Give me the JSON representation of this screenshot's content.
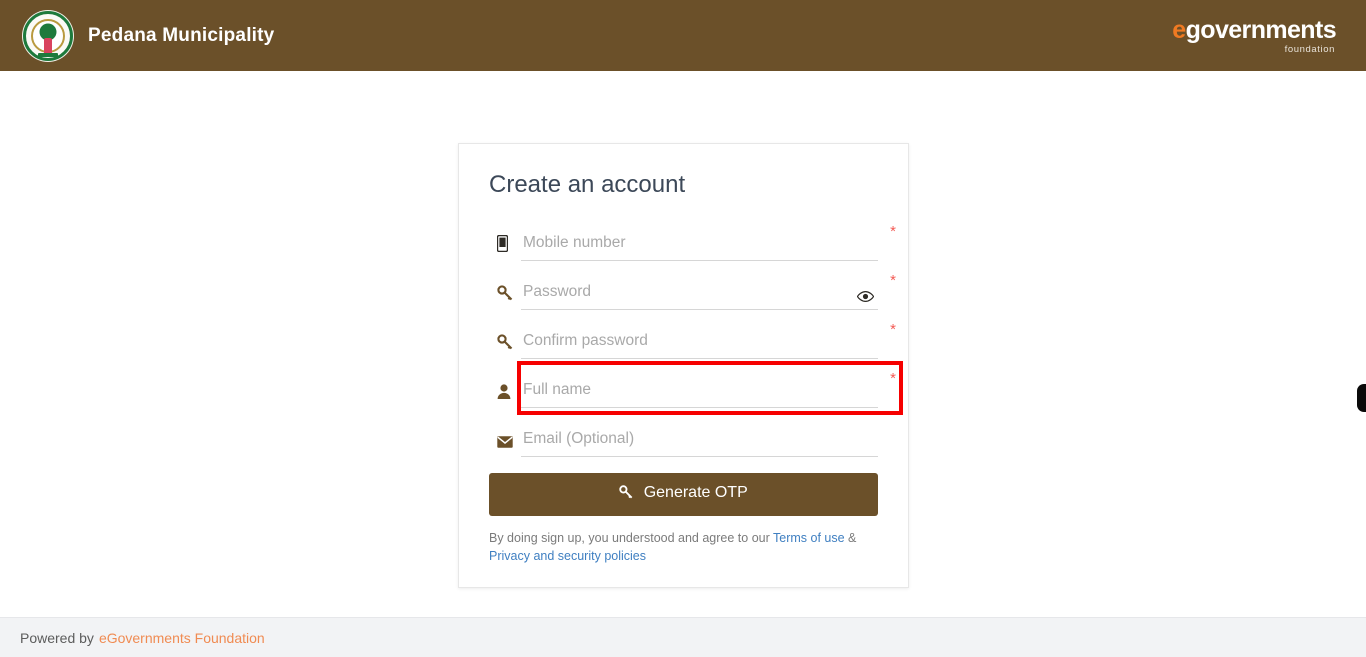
{
  "header": {
    "emblem_icon": "ap-state-emblem-icon",
    "title": "Pedana Municipality",
    "logo": {
      "e_mark": "e",
      "word": "governments",
      "subtitle": "foundation"
    }
  },
  "card": {
    "title": "Create an account",
    "fields": [
      {
        "name": "mobile-number",
        "icon": "mobile-icon",
        "placeholder": "Mobile number",
        "value": "",
        "required_mark": "*",
        "highlighted": false
      },
      {
        "name": "password",
        "icon": "key-icon",
        "placeholder": "Password",
        "value": "",
        "required_mark": "*",
        "highlighted": false,
        "toggle_icon": "eye-icon"
      },
      {
        "name": "confirm-password",
        "icon": "key-icon",
        "placeholder": "Confirm password",
        "value": "",
        "required_mark": "*",
        "highlighted": false
      },
      {
        "name": "full-name",
        "icon": "user-icon",
        "placeholder": "Full name",
        "value": "",
        "required_mark": "*",
        "highlighted": true
      },
      {
        "name": "email",
        "icon": "envelope-icon",
        "placeholder": "Email (Optional)",
        "value": "",
        "required_mark": "",
        "highlighted": false
      }
    ],
    "submit_button": {
      "icon": "key-icon",
      "label": "Generate OTP"
    },
    "terms": {
      "prefix": "By doing sign up, you understood and agree to our ",
      "link1": "Terms of use",
      "separator": " & ",
      "link2": "Privacy and security policies"
    }
  },
  "edge_tab": {
    "name": "side-drawer-handle"
  },
  "footer": {
    "prefix": "Powered by",
    "link": "eGovernments Foundation"
  },
  "colors": {
    "brand_brown": "#6b5029",
    "accent_orange": "#f07a22",
    "required_red": "#f35b55",
    "highlight_red": "#f60000",
    "link_blue": "#3f7fc1",
    "footer_link": "#f08b52"
  }
}
